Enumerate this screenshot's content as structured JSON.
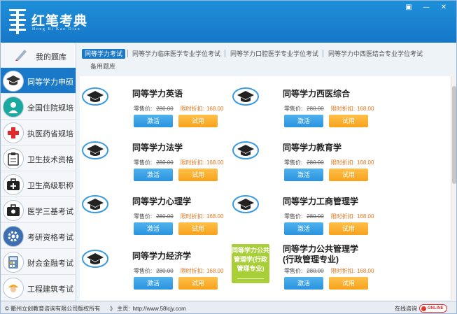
{
  "app": {
    "title": "红笔考典",
    "subtitle": "Hong Bi Kao Dian",
    "window_controls": {
      "restore": "▣",
      "minimize": "—",
      "close": "✕"
    }
  },
  "sidebar": {
    "items": [
      {
        "label": "我的题库",
        "icon": "pen-icon",
        "active": false
      },
      {
        "label": "同等学力申硕",
        "icon": "graduation-cap-icon",
        "active": true
      },
      {
        "label": "全国住院规培",
        "icon": "doctor-icon",
        "active": false
      },
      {
        "label": "执医药省规培",
        "icon": "red-cross-icon",
        "active": false
      },
      {
        "label": "卫生技术资格",
        "icon": "clipboard-icon",
        "active": false
      },
      {
        "label": "卫生高级职称",
        "icon": "medical-kit-icon",
        "active": false
      },
      {
        "label": "医学三基考试",
        "icon": "first-aid-box-icon",
        "active": false
      },
      {
        "label": "考研资格考试",
        "icon": "gear-icon",
        "active": false
      },
      {
        "label": "财会金融考试",
        "icon": "calculator-icon",
        "active": false
      },
      {
        "label": "工程建筑考试",
        "icon": "worker-icon",
        "active": false
      }
    ]
  },
  "tabs": {
    "items": [
      {
        "label": "同等学力考试",
        "active": true
      },
      {
        "label": "同等学力临床医学专业学位考试",
        "active": false
      },
      {
        "label": "同等学力口腔医学专业学位考试",
        "active": false
      },
      {
        "label": "同等学力中西医结合专业学位考试",
        "active": false
      }
    ],
    "row2": "备用题库"
  },
  "price_labels": {
    "orig_label": "零售价:",
    "limit_label": "限时折扣:"
  },
  "buttons": {
    "activate": "激活",
    "trial": "试用"
  },
  "courses": [
    {
      "title": "同等学力英语",
      "orig_price": "280.00",
      "limit_price": "168.00"
    },
    {
      "title": "同等学力西医综合",
      "orig_price": "280.00",
      "limit_price": "168.00"
    },
    {
      "title": "同等学力法学",
      "orig_price": "280.00",
      "limit_price": "168.00"
    },
    {
      "title": "同等学力教育学",
      "orig_price": "280.00",
      "limit_price": "168.00"
    },
    {
      "title": "同等学力心理学",
      "orig_price": "280.00",
      "limit_price": "168.00"
    },
    {
      "title": "同等学力工商管理学",
      "orig_price": "280.00",
      "limit_price": "168.00"
    },
    {
      "title": "同等学力经济学",
      "orig_price": "280.00",
      "limit_price": "168.00"
    },
    {
      "title": "同等学力公共管理学(行政管理专业)",
      "orig_price": "280.00",
      "limit_price": "168.00"
    }
  ],
  "promo": {
    "text": "同等学力公共管理学(行政管理专业)"
  },
  "footer": {
    "copyright": "© 衢州立创教育咨询有限公司版权所有",
    "home_label": "》 主页:",
    "home_url": "http://www.58lcjy.com",
    "consult": "在线咨询",
    "online": "ONLINE"
  },
  "colors": {
    "primary": "#1a78c8",
    "trial": "#f7a21c",
    "activate": "#2a93de",
    "promo": "#a9cf38",
    "discount": "#e8741a"
  }
}
